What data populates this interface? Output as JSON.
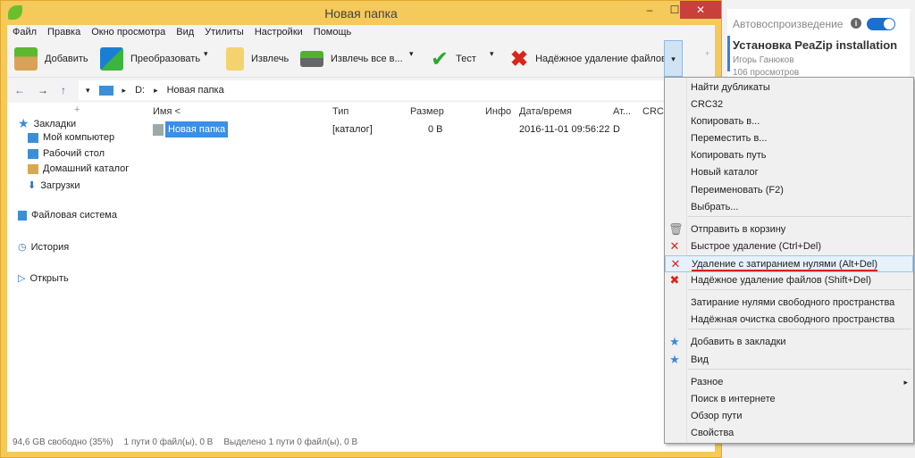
{
  "window": {
    "title": "Новая папка",
    "minimize": "‒",
    "maximize": "☐",
    "close": "✕"
  },
  "menu": [
    "Файл",
    "Правка",
    "Окно просмотра",
    "Вид",
    "Утилиты",
    "Настройки",
    "Помощь"
  ],
  "toolbar": {
    "add": "Добавить",
    "convert": "Преобразовать",
    "extract": "Извлечь",
    "extract_all": "Извлечь все в...",
    "test": "Тест",
    "secure_delete": "Надёжное удаление файлов",
    "dropdown": "▾",
    "plus": "+"
  },
  "address": {
    "back": "←",
    "forward": "→",
    "up": "↑",
    "drive": "D:",
    "folder": "Новая папка",
    "sep": "▸"
  },
  "sidebar": {
    "collapse": "+",
    "bookmarks": "Закладки",
    "my_computer": "Мой компьютер",
    "desktop": "Рабочий стол",
    "home": "Домашний каталог",
    "downloads": "Загрузки",
    "filesystem": "Файловая система",
    "history": "История",
    "open": "Открыть"
  },
  "columns": {
    "name": "Имя <",
    "type": "Тип",
    "size": "Размер",
    "info": "Инфо",
    "date": "Дата/время",
    "attr": "Ат...",
    "crc": "CRC3"
  },
  "rows": [
    {
      "name": "Новая папка",
      "type": "[каталог]",
      "size": "0 B",
      "info": "",
      "date": "2016-11-01 09:56:22",
      "attr": "D"
    }
  ],
  "status": {
    "free": "94,6 GB свободно (35%)",
    "total": "1 пути 0 файл(ы), 0 B",
    "selected": "Выделено 1 пути 0 файл(ы), 0 B"
  },
  "right_panel": {
    "autoplay": "Автовоспроизведение",
    "info": "i",
    "video_title": "Установка PeaZip installation",
    "author": "Игорь Ганюков",
    "views": "106 просмотров",
    "toggle_on": true
  },
  "context_menu": [
    {
      "label": "Найти дубликаты"
    },
    {
      "label": "CRC32"
    },
    {
      "label": "Копировать в..."
    },
    {
      "label": "Переместить в..."
    },
    {
      "label": "Копировать путь"
    },
    {
      "label": "Новый каталог"
    },
    {
      "label": "Переименовать (F2)"
    },
    {
      "label": "Выбрать..."
    },
    {
      "label": "Отправить в корзину",
      "icon": "🗑"
    },
    {
      "label": "Быстрое удаление (Ctrl+Del)",
      "icon": "✕"
    },
    {
      "label": "Удаление с затиранием нулями (Alt+Del)",
      "icon": "✕",
      "highlighted": true
    },
    {
      "label": "Надёжное удаление файлов (Shift+Del)",
      "icon": "✖"
    },
    {
      "label": "Затирание нулями свободного пространства"
    },
    {
      "label": "Надёжная очистка свободного пространства"
    },
    {
      "label": "Добавить в закладки",
      "icon": "★"
    },
    {
      "label": "Вид",
      "icon": "★"
    },
    {
      "label": "Разное",
      "submenu": "▸"
    },
    {
      "label": "Поиск в интернете"
    },
    {
      "label": "Обзор пути"
    },
    {
      "label": "Свойства"
    }
  ]
}
